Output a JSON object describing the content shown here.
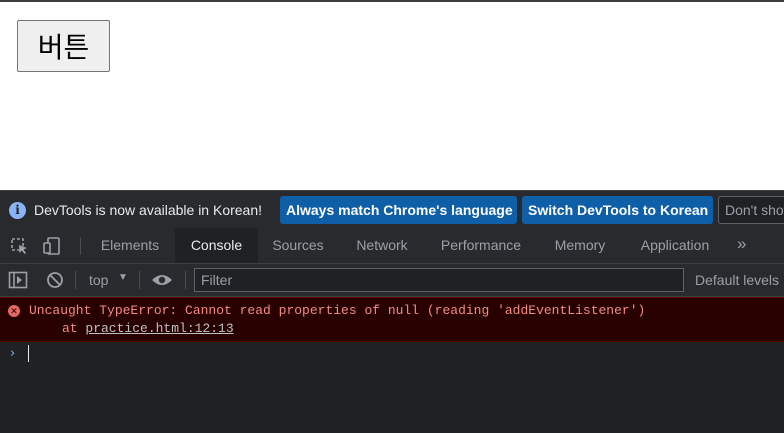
{
  "page": {
    "button_label": "버튼"
  },
  "infobar": {
    "message": "DevTools is now available in Korean!",
    "btn_match": "Always match Chrome's language",
    "btn_switch": "Switch DevTools to Korean",
    "btn_dont": "Don't show again"
  },
  "tabs": [
    "Elements",
    "Console",
    "Sources",
    "Network",
    "Performance",
    "Memory",
    "Application"
  ],
  "active_tab": "Console",
  "console_toolbar": {
    "context": "top",
    "filter_placeholder": "Filter",
    "levels": "Default levels"
  },
  "error": {
    "message": "Uncaught TypeError: Cannot read properties of null (reading 'addEventListener')",
    "at_prefix": "at ",
    "location": "practice.html:12:13"
  },
  "colors": {
    "error_text": "#f28b82",
    "error_bg": "#290000",
    "accent_button": "#0f5fa8"
  }
}
